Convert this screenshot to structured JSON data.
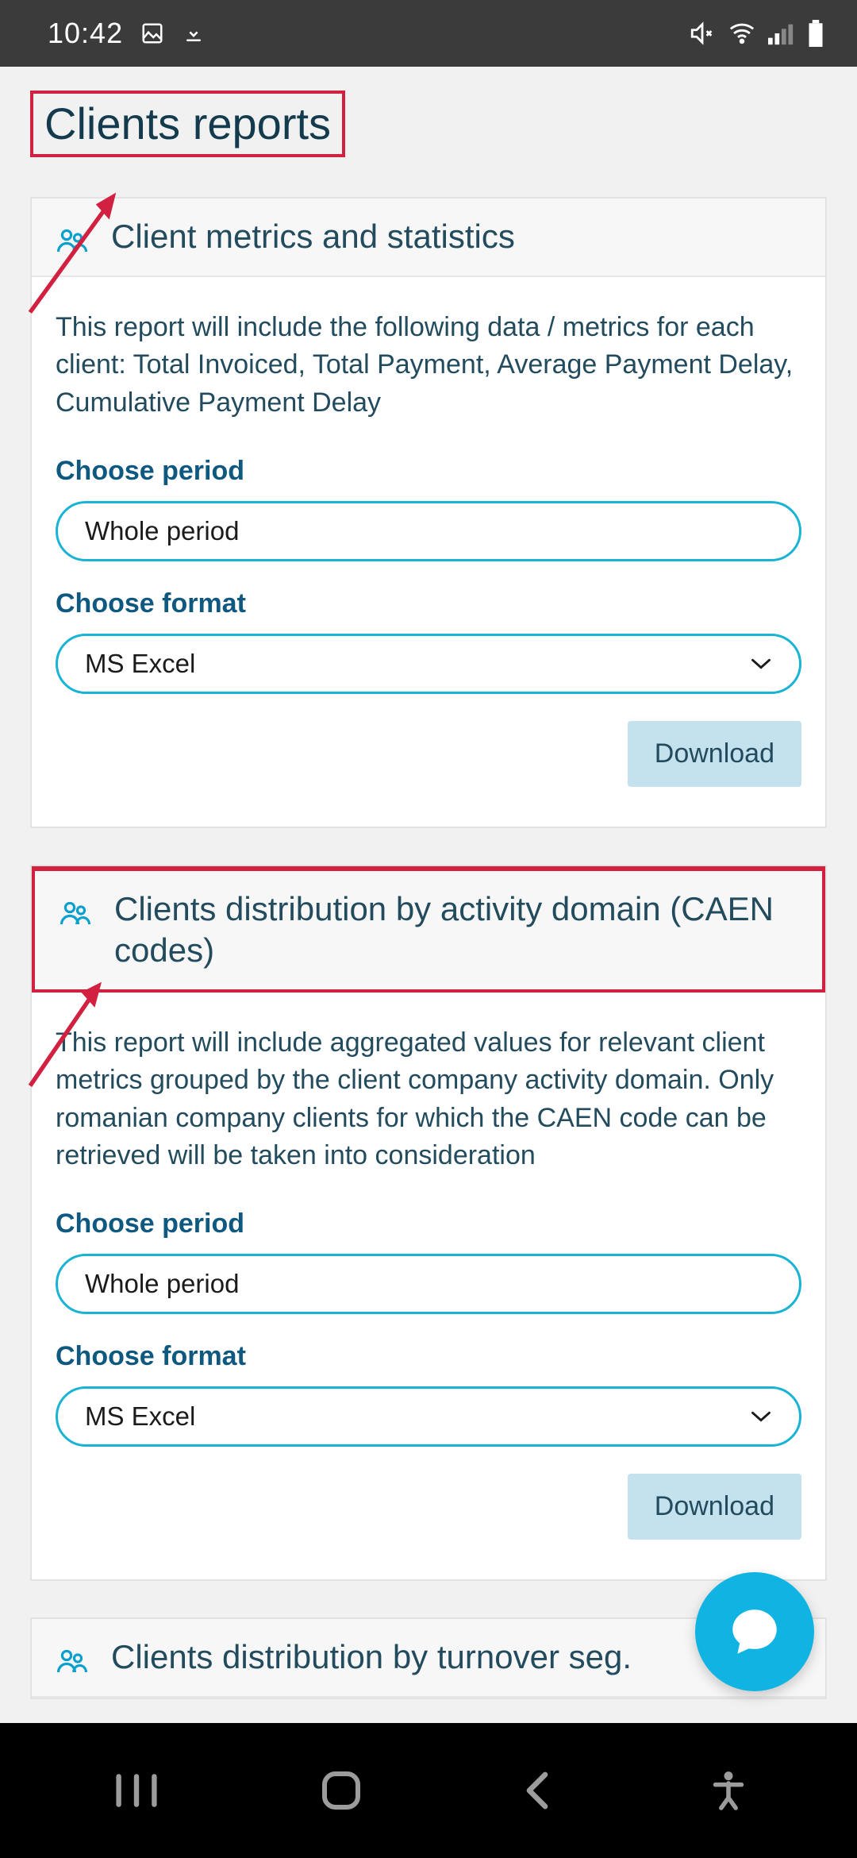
{
  "status_bar": {
    "time": "10:42"
  },
  "page_title": "Clients reports",
  "cards": [
    {
      "title": "Client metrics and statistics",
      "description": "This report will include the following data / metrics for each client: Total Invoiced, Total Payment, Average Payment Delay, Cumulative Payment Delay",
      "period_label": "Choose period",
      "period_value": "Whole period",
      "format_label": "Choose format",
      "format_value": "MS Excel",
      "download_label": "Download"
    },
    {
      "title": "Clients distribution by activity domain (CAEN codes)",
      "description": "This report will include aggregated values for relevant client metrics grouped by the client company activity domain. Only romanian company clients for which the CAEN code can be retrieved will be taken into consideration",
      "period_label": "Choose period",
      "period_value": "Whole period",
      "format_label": "Choose format",
      "format_value": "MS Excel",
      "download_label": "Download"
    },
    {
      "title": "Clients distribution by turnover seg."
    }
  ],
  "icons": {
    "people": "people-icon",
    "chevron_down": "chevron-down-icon",
    "chat": "chat-icon"
  }
}
